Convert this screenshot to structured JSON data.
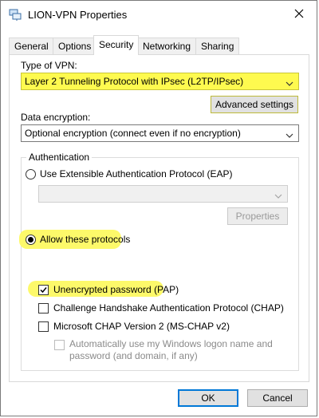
{
  "window": {
    "title": "LION-VPN Properties",
    "close_symbol": "✕",
    "app_icon": "network-connection-icon",
    "highlight_color": "#fdf96a"
  },
  "tabs": [
    {
      "label": "General",
      "active": false
    },
    {
      "label": "Options",
      "active": false
    },
    {
      "label": "Security",
      "active": true
    },
    {
      "label": "Networking",
      "active": false
    },
    {
      "label": "Sharing",
      "active": false
    }
  ],
  "security": {
    "vpn_type_label": "Type of VPN:",
    "vpn_type_value": "Layer 2 Tunneling Protocol with IPsec (L2TP/IPsec)",
    "advanced_settings_label": "Advanced settings",
    "data_encryption_label": "Data encryption:",
    "data_encryption_value": "Optional encryption (connect even if no encryption)",
    "authentication": {
      "group_label": "Authentication",
      "eap_option_label": "Use Extensible Authentication Protocol (EAP)",
      "eap_selected": false,
      "eap_dropdown_value": "",
      "properties_label": "Properties",
      "allow_protocols_label": "Allow these protocols",
      "allow_protocols_selected": true,
      "protocols": [
        {
          "label": "Unencrypted password (PAP)",
          "checked": true
        },
        {
          "label": "Challenge Handshake Authentication Protocol (CHAP)",
          "checked": false
        },
        {
          "label": "Microsoft CHAP Version 2 (MS-CHAP v2)",
          "checked": false
        }
      ],
      "auto_logon_line1": "Automatically use my Windows logon name and",
      "auto_logon_line2": "password (and domain, if any)",
      "auto_logon_checked": false
    }
  },
  "footer": {
    "ok_label": "OK",
    "cancel_label": "Cancel"
  }
}
